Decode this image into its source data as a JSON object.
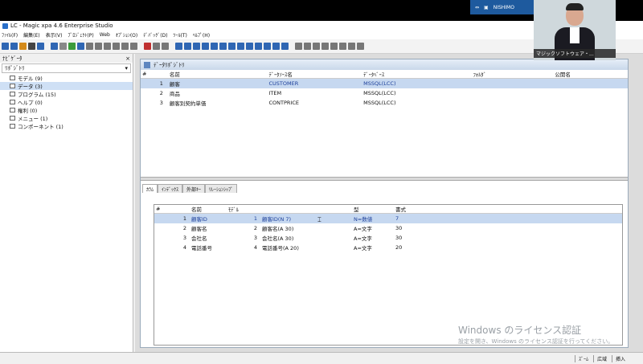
{
  "window": {
    "title": "LC - Magic xpa 4.6 Enterprise Studio",
    "user": "NISHIMO"
  },
  "menu": [
    "ﾌｧｲﾙ(F)",
    "編集(E)",
    "表示(V)",
    "ﾌﾟﾛｼﾞｪｸﾄ(P)",
    "Web",
    "ｵﾌﾟｼｮﾝ(O)",
    "ﾃﾞﾊﾞｯｸﾞ(D)",
    "ﾂｰﾙ(T)",
    "ﾍﾙﾌﾟ(H)"
  ],
  "toolbar_colors": [
    "#2f66b3",
    "#2f66b3",
    "#d48a1a",
    "#444",
    "#2f66b3",
    "#2f66b3",
    "#888",
    "#3b9b3b",
    "#2f66b3",
    "#777",
    "#777",
    "#777",
    "#777",
    "#777",
    "#777",
    "#c03030",
    "#777",
    "#777",
    "#2f66b3",
    "#2f66b3",
    "#2f66b3",
    "#2f66b3",
    "#2f66b3",
    "#2f66b3",
    "#2f66b3",
    "#2f66b3",
    "#2f66b3",
    "#2f66b3",
    "#2f66b3",
    "#2f66b3",
    "#2f66b3",
    "#777",
    "#777",
    "#777",
    "#777",
    "#777",
    "#777",
    "#777",
    "#777"
  ],
  "navigator": {
    "title": "ﾅﾋﾞｹﾞｰﾀ",
    "close": "×",
    "dropdown": "ﾘﾎﾟｼﾞﾄﾘ",
    "items": [
      {
        "label": "モデル (9)",
        "selected": false
      },
      {
        "label": "データ (3)",
        "selected": true
      },
      {
        "label": "プログラム (15)",
        "selected": false
      },
      {
        "label": "ヘルプ (0)",
        "selected": false
      },
      {
        "label": "権利 (0)",
        "selected": false
      },
      {
        "label": "メニュー (1)",
        "selected": false
      },
      {
        "label": "コンポーネント (1)",
        "selected": false
      }
    ]
  },
  "data_repository": {
    "title": "ﾃﾞｰﾀﾘﾎﾟｼﾞﾄﾘ",
    "columns": [
      "#",
      "名前",
      "ﾃﾞｰﾀｿｰｽ名",
      "ﾃﾞｰﾀﾍﾞｰｽ",
      "ﾌｫﾙﾀﾞ",
      "公開名"
    ],
    "rows": [
      {
        "num": "1",
        "name": "顧客",
        "source": "CUSTOMER",
        "database": "MSSQL(LCC)",
        "folder": "",
        "public": "",
        "selected": true
      },
      {
        "num": "2",
        "name": "商品",
        "source": "ITEM",
        "database": "MSSQL(LCC)",
        "folder": "",
        "public": "",
        "selected": false
      },
      {
        "num": "3",
        "name": "顧客別契約単価",
        "source": "CONTPRICE",
        "database": "MSSQL(LCC)",
        "folder": "",
        "public": "",
        "selected": false
      }
    ]
  },
  "tabs": [
    "ｶﾗﾑ",
    "ｲﾝﾃﾞｯｸｽ",
    "外部ｷｰ",
    "ﾘﾚｰｼｮﾝｼｯﾌﾟ"
  ],
  "columns_grid": {
    "columns": [
      "#",
      "名前",
      "ﾓﾃﾞﾙ",
      "",
      "型",
      "書式"
    ],
    "rows": [
      {
        "num": "1",
        "name": "顧客ID",
        "model_num": "1",
        "model": "顧客ID(N 7)",
        "type": "N=数値",
        "format": "7",
        "selected": true
      },
      {
        "num": "2",
        "name": "顧客名",
        "model_num": "2",
        "model": "顧客名(A 30)",
        "type": "A=文字",
        "format": "30",
        "selected": false
      },
      {
        "num": "3",
        "name": "会社名",
        "model_num": "3",
        "model": "会社名(A 30)",
        "type": "A=文字",
        "format": "30",
        "selected": false
      },
      {
        "num": "4",
        "name": "電話番号",
        "model_num": "4",
        "model": "電話番号(A 20)",
        "type": "A=文字",
        "format": "20",
        "selected": false
      }
    ]
  },
  "status": [
    "ｽﾞｰﾑ",
    "広域",
    "挿入"
  ],
  "watermark": {
    "line1": "Windows のライセンス認証",
    "line2": "設定を開き、Windows のライセンス認証を行ってください。"
  },
  "video": {
    "caption": "マジックソフトウェア・..."
  }
}
